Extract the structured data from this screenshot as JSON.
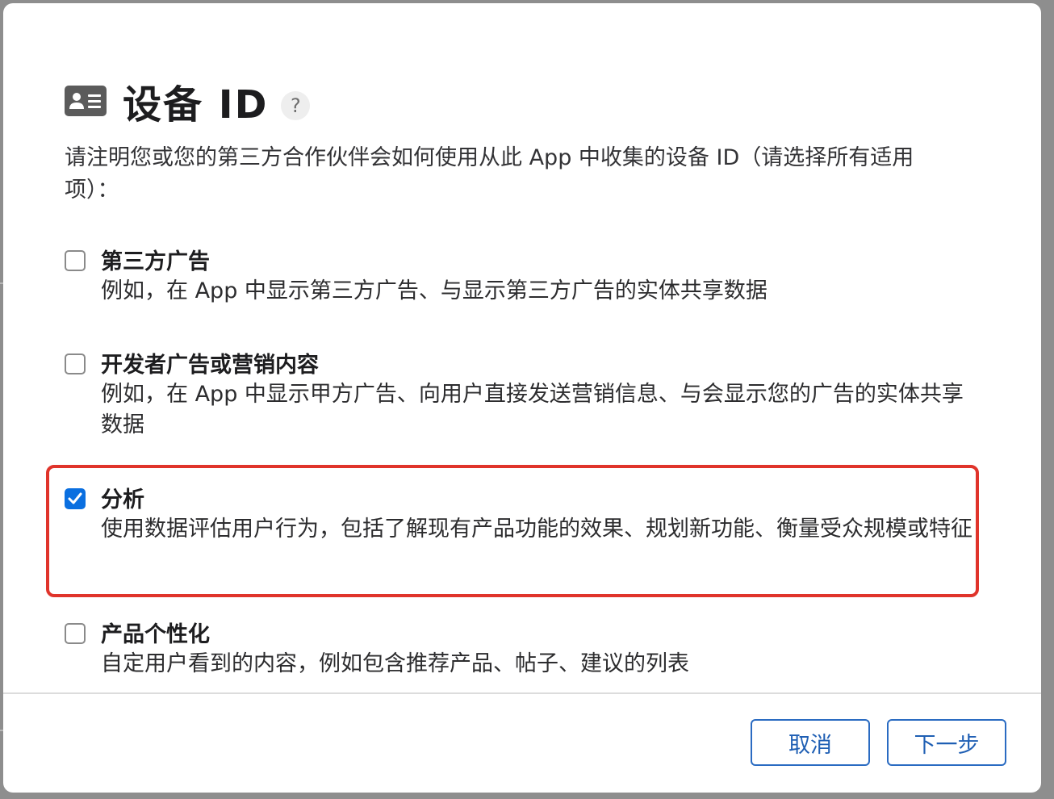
{
  "dialog": {
    "title": "设备 ID",
    "help_label": "?",
    "intro": "请注明您或您的第三方合作伙伴会如何使用从此 App 中收集的设备 ID（请选择所有适用项）：",
    "options": [
      {
        "title": "第三方广告",
        "description": "例如，在 App 中显示第三方广告、与显示第三方广告的实体共享数据",
        "checked": false
      },
      {
        "title": "开发者广告或营销内容",
        "description": "例如，在 App 中显示甲方广告、向用户直接发送营销信息、与会显示您的广告的实体共享数据",
        "checked": false
      },
      {
        "title": "分析",
        "description": "使用数据评估用户行为，包括了解现有产品功能的效果、规划新功能、衡量受众规模或特征",
        "checked": true
      },
      {
        "title": "产品个性化",
        "description": "自定用户看到的内容，例如包含推荐产品、帖子、建议的列表",
        "checked": false
      }
    ],
    "buttons": {
      "cancel": "取消",
      "next": "下一步"
    }
  },
  "colors": {
    "accent": "#0a6fe0",
    "highlight_border": "#e0342b",
    "button_text": "#1f5fb4"
  },
  "icons": {
    "header": "id-card-icon",
    "checked": "checkmark-icon"
  }
}
